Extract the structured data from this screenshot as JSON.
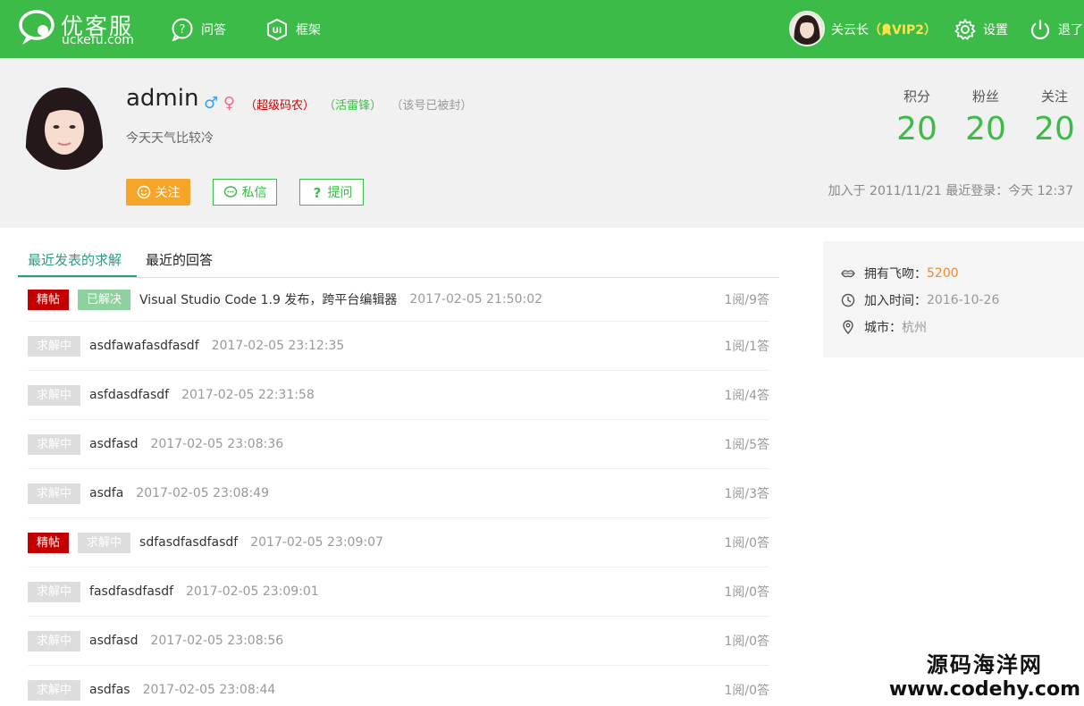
{
  "nav": {
    "logo_cn": "优客服",
    "logo_en": "uckefu.com",
    "qa_label": "问答",
    "framework_label": "框架",
    "user_name": "关云长",
    "vip_open": "（",
    "vip_label": "VIP2",
    "vip_close": "）",
    "settings_label": "设置",
    "logout_label": "退了"
  },
  "profile": {
    "username": "admin",
    "gender_male": "♂",
    "gender_female": "♀",
    "title_coder": "（超级码农）",
    "title_leifeng": "（活雷锋）",
    "title_banned": "（该号已被封）",
    "signature": "今天天气比较冷",
    "btn_follow": "关注",
    "btn_message": "私信",
    "btn_ask": "提问",
    "stats": [
      {
        "label": "积分",
        "value": "20"
      },
      {
        "label": "粉丝",
        "value": "20"
      },
      {
        "label": "关注",
        "value": "20"
      }
    ],
    "join_info": "加入于 2011/11/21 最近登录：今天 12:37"
  },
  "tabs": [
    {
      "label": "最近发表的求解",
      "active": true
    },
    {
      "label": "最近的回答",
      "active": false
    }
  ],
  "questions": [
    {
      "badges": [
        {
          "text": "精帖",
          "kind": "jing"
        },
        {
          "text": "已解决",
          "kind": "solved"
        }
      ],
      "title": "Visual Studio Code 1.9 发布，跨平台编辑器",
      "time": "2017-02-05 21:50:02",
      "count": "1阅/9答"
    },
    {
      "badges": [
        {
          "text": "求解中",
          "kind": "pending"
        }
      ],
      "title": "asdfawafasdfasdf",
      "time": "2017-02-05 23:12:35",
      "count": "1阅/1答"
    },
    {
      "badges": [
        {
          "text": "求解中",
          "kind": "pending"
        }
      ],
      "title": "asfdasdfasdf",
      "time": "2017-02-05 22:31:58",
      "count": "1阅/4答"
    },
    {
      "badges": [
        {
          "text": "求解中",
          "kind": "pending"
        }
      ],
      "title": "asdfasd",
      "time": "2017-02-05 23:08:36",
      "count": "1阅/5答"
    },
    {
      "badges": [
        {
          "text": "求解中",
          "kind": "pending"
        }
      ],
      "title": "asdfa",
      "time": "2017-02-05 23:08:49",
      "count": "1阅/3答"
    },
    {
      "badges": [
        {
          "text": "精帖",
          "kind": "jing"
        },
        {
          "text": "求解中",
          "kind": "pending"
        }
      ],
      "title": "sdfasdfasdfasdf",
      "time": "2017-02-05 23:09:07",
      "count": "1阅/0答"
    },
    {
      "badges": [
        {
          "text": "求解中",
          "kind": "pending"
        }
      ],
      "title": "fasdfasdfasdf",
      "time": "2017-02-05 23:09:01",
      "count": "1阅/0答"
    },
    {
      "badges": [
        {
          "text": "求解中",
          "kind": "pending"
        }
      ],
      "title": "asdfasd",
      "time": "2017-02-05 23:08:56",
      "count": "1阅/0答"
    },
    {
      "badges": [
        {
          "text": "求解中",
          "kind": "pending"
        }
      ],
      "title": "asdfas",
      "time": "2017-02-05 23:08:44",
      "count": "1阅/0答"
    }
  ],
  "side": {
    "kisses_label": "拥有飞吻：",
    "kisses_value": "5200",
    "join_label": "加入时间：",
    "join_value": "2016-10-26",
    "city_label": "城市：",
    "city_value": "杭州"
  },
  "watermark": {
    "cn": "源码海洋网",
    "en": "www.codehy.com"
  },
  "colors": {
    "brand_green": "#3dbb48",
    "tab_active": "#2f9a86",
    "badge_jing": "#c20000",
    "badge_solved": "#8fd19e",
    "badge_pending": "#dddddd",
    "follow_orange": "#f7a529",
    "vip_yellow": "#ffe14a"
  }
}
